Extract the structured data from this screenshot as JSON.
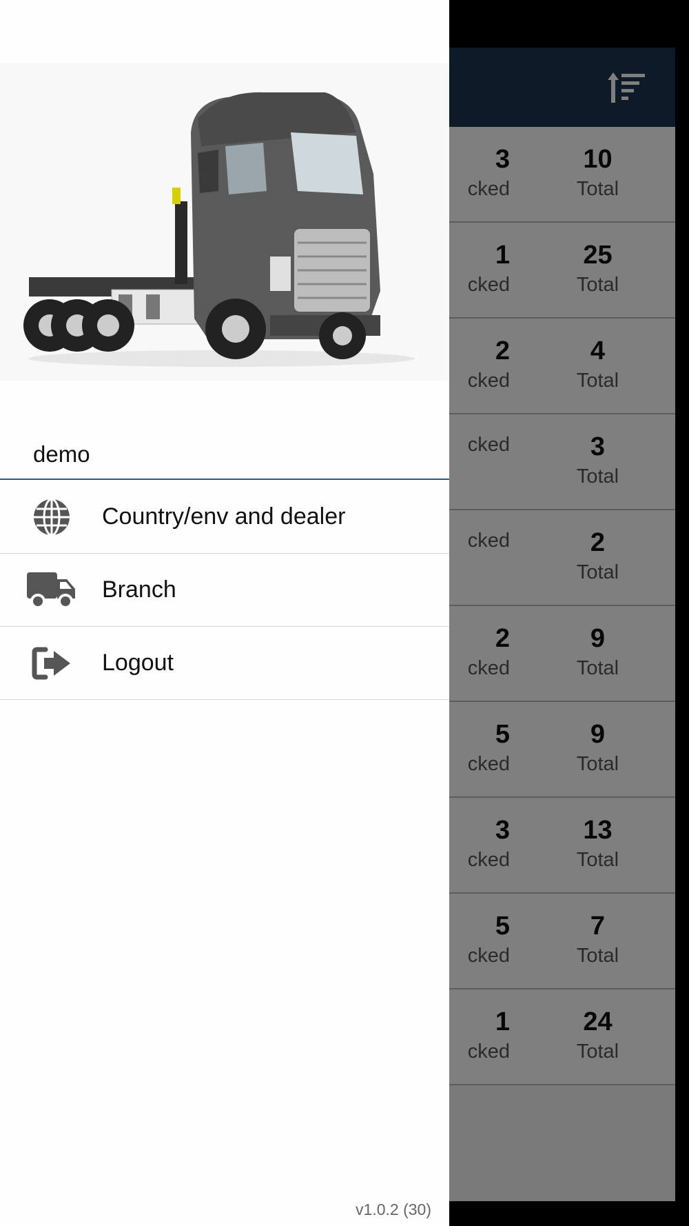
{
  "drawer": {
    "username": "demo",
    "menu": [
      {
        "label": "Country/env and dealer",
        "icon": "globe-icon"
      },
      {
        "label": "Branch",
        "icon": "truck-icon"
      },
      {
        "label": "Logout",
        "icon": "logout-icon"
      }
    ],
    "version": "v1.0.2 (30)",
    "image": "truck-image"
  },
  "background": {
    "header_icon": "sort-icon",
    "rows": [
      {
        "left_value": "3",
        "left_label": "cked",
        "total": "10",
        "total_label": "Total"
      },
      {
        "left_value": "1",
        "left_label": "cked",
        "total": "25",
        "total_label": "Total"
      },
      {
        "left_value": "2",
        "left_label": "cked",
        "total": "4",
        "total_label": "Total"
      },
      {
        "left_value": "",
        "left_label": "cked",
        "total": "3",
        "total_label": "Total"
      },
      {
        "left_value": "",
        "left_label": "cked",
        "total": "2",
        "total_label": "Total"
      },
      {
        "left_value": "2",
        "left_label": "cked",
        "total": "9",
        "total_label": "Total"
      },
      {
        "left_value": "5",
        "left_label": "cked",
        "total": "9",
        "total_label": "Total"
      },
      {
        "left_value": "3",
        "left_label": "cked",
        "total": "13",
        "total_label": "Total"
      },
      {
        "left_value": "5",
        "left_label": "cked",
        "total": "7",
        "total_label": "Total"
      },
      {
        "left_value": "1",
        "left_label": "cked",
        "total": "24",
        "total_label": "Total"
      }
    ]
  },
  "colors": {
    "header_bg": "#1f3450",
    "divider": "#2f5a86",
    "icon": "#555555"
  }
}
